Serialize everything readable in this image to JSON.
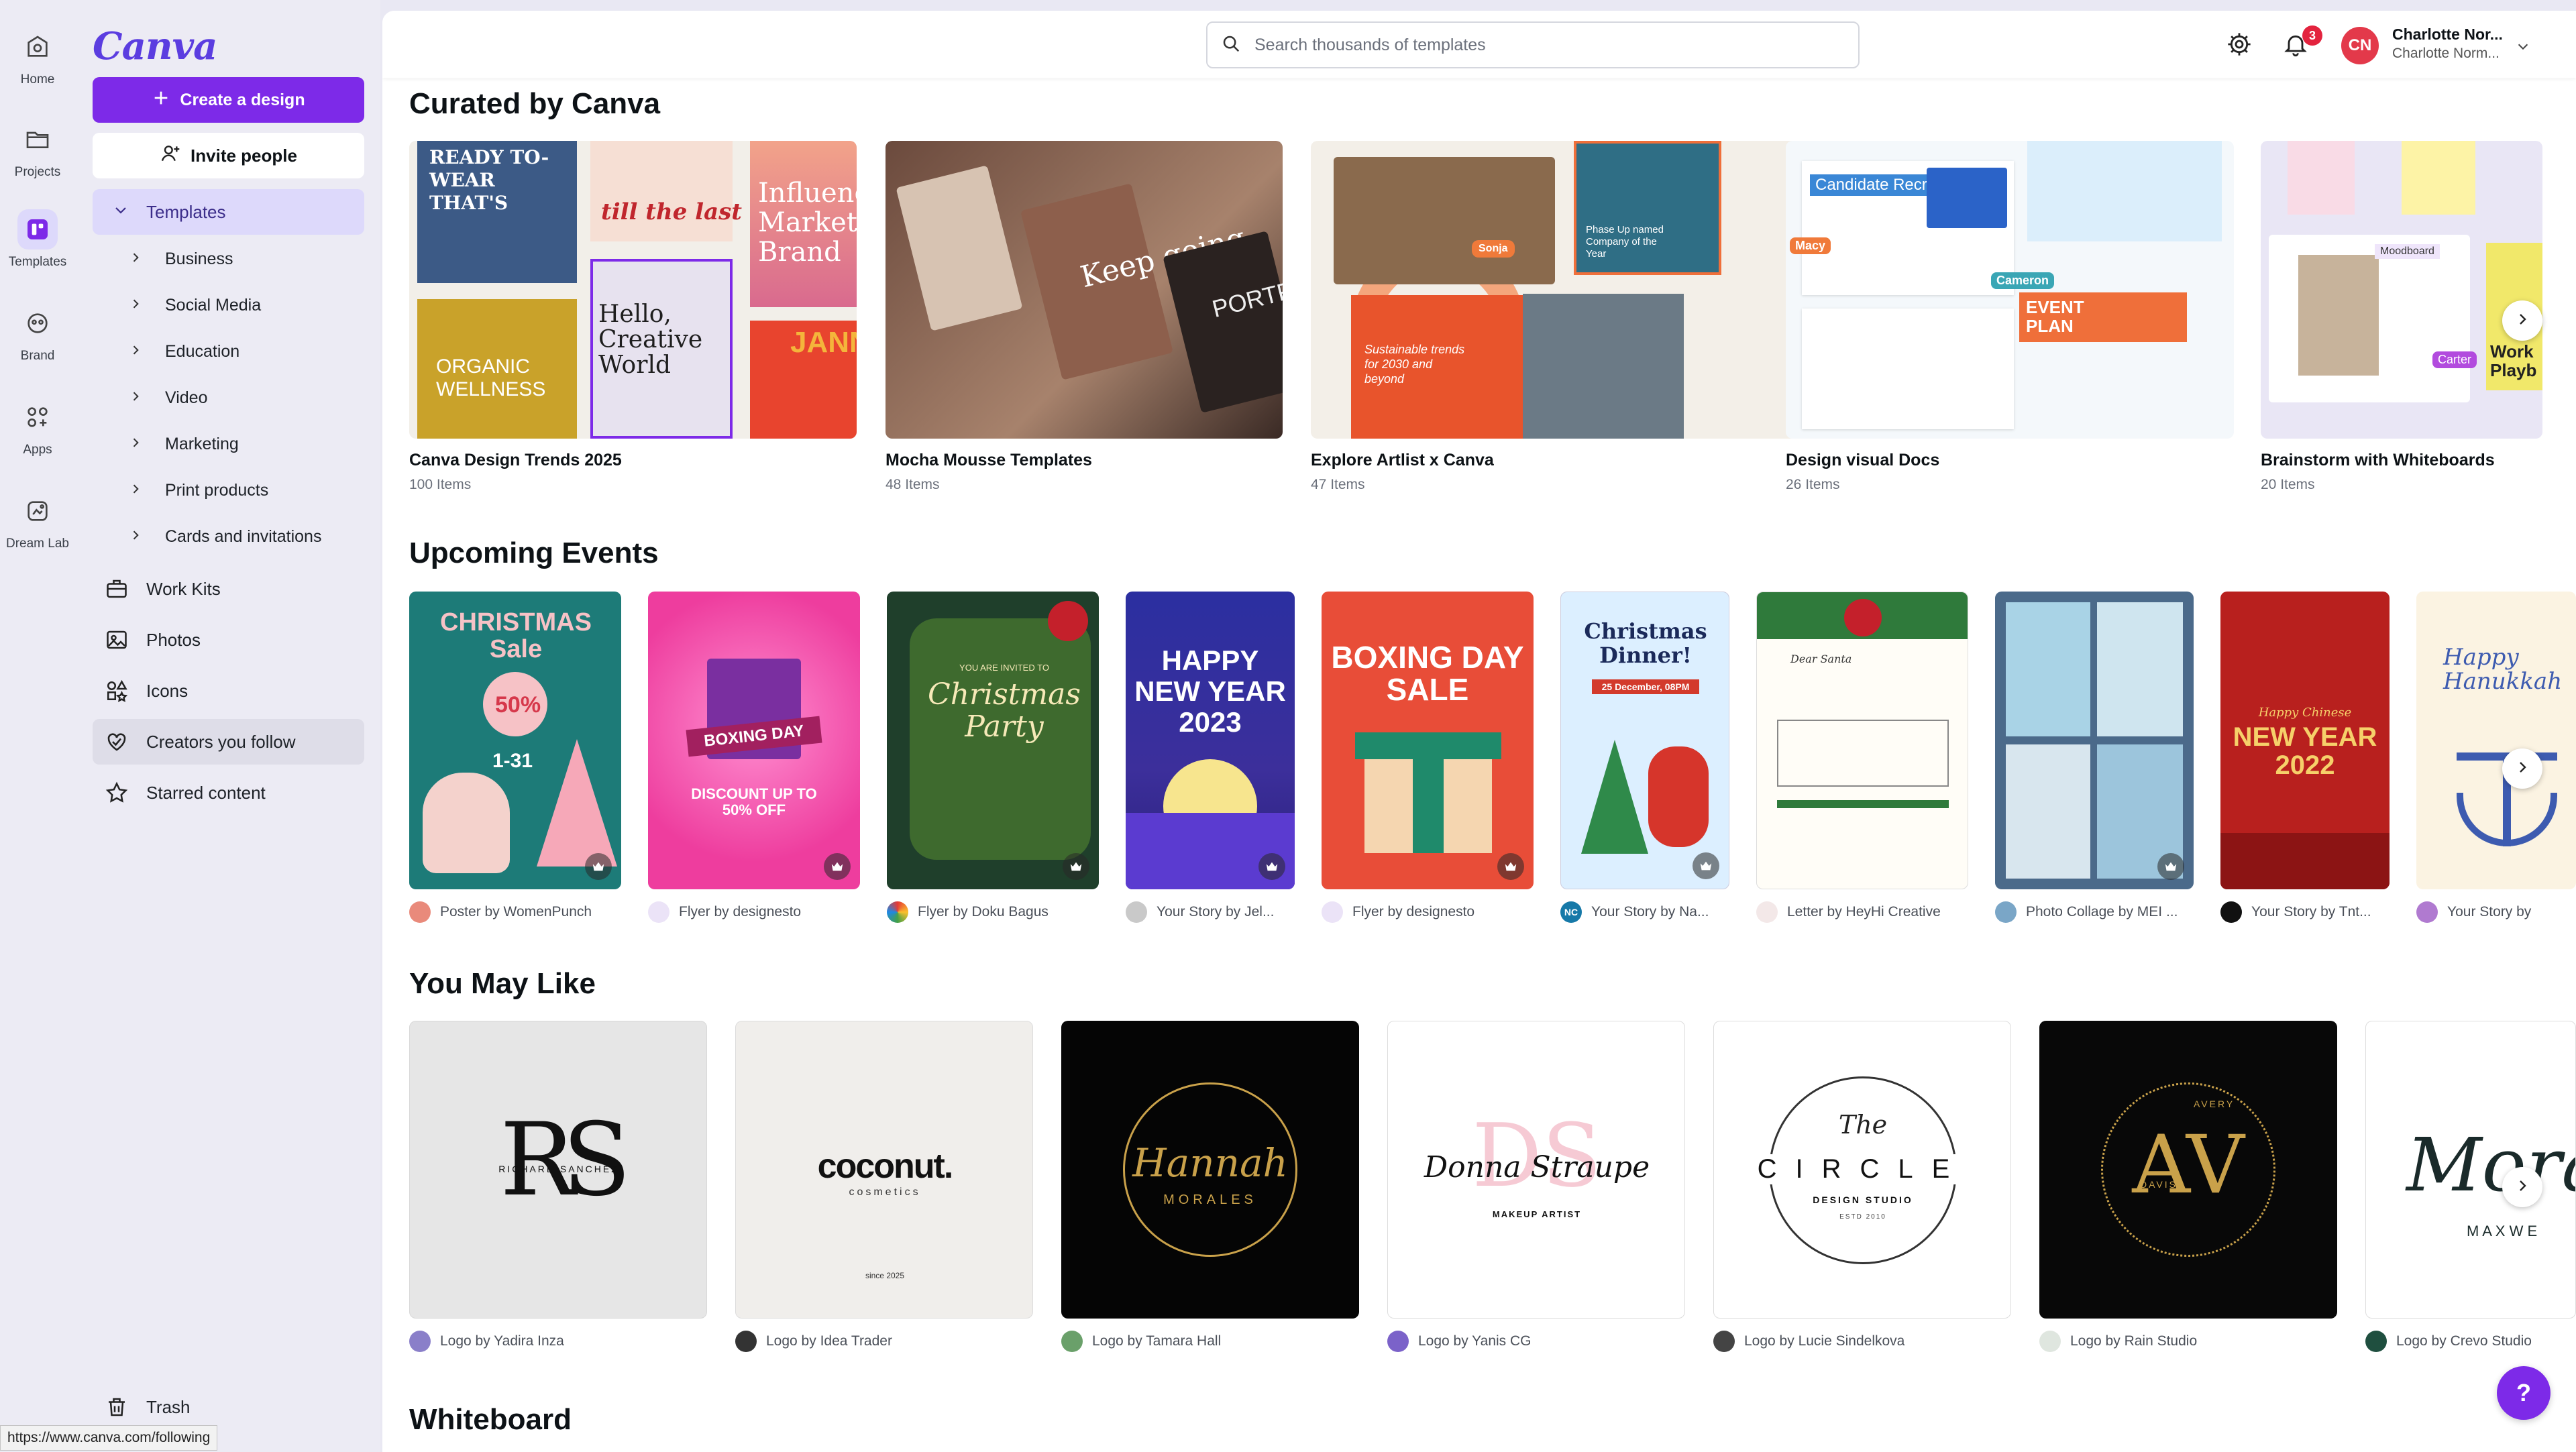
{
  "rail": [
    {
      "label": "Home",
      "icon": "home-icon"
    },
    {
      "label": "Projects",
      "icon": "folder-icon"
    },
    {
      "label": "Templates",
      "icon": "templates-icon"
    },
    {
      "label": "Brand",
      "icon": "brand-icon"
    },
    {
      "label": "Apps",
      "icon": "apps-icon"
    },
    {
      "label": "Dream Lab",
      "icon": "dream-lab-icon"
    }
  ],
  "sidebar": {
    "logo": "Canva",
    "create_label": "Create a design",
    "invite_label": "Invite people",
    "templates_label": "Templates",
    "sub_items": [
      "Business",
      "Social Media",
      "Education",
      "Video",
      "Marketing",
      "Print products",
      "Cards and invitations"
    ],
    "nav": [
      "Work Kits",
      "Photos",
      "Icons",
      "Creators you follow",
      "Starred content"
    ],
    "trash_label": "Trash"
  },
  "topbar": {
    "search_placeholder": "Search thousands of templates",
    "notif_count": "3",
    "avatar_initials": "CN",
    "user_name": "Charlotte Nor...",
    "user_sub": "Charlotte Norm..."
  },
  "curated": {
    "title": "Curated by Canva",
    "cards": [
      {
        "title": "Canva Design Trends 2025",
        "count": "100 Items"
      },
      {
        "title": "Mocha Mousse Templates",
        "count": "48 Items"
      },
      {
        "title": "Explore Artlist x Canva",
        "count": "47 Items"
      },
      {
        "title": "Design visual Docs",
        "count": "26 Items"
      },
      {
        "title": "Brainstorm with Whiteboards",
        "count": "20 Items"
      }
    ],
    "thumb_text": {
      "c1a": "READY TO-WEAR THAT'S",
      "c1b": "till the last bite",
      "c1c": "Influence Marketing Brand",
      "c1d": "ORGANIC WELLNESS",
      "c1e": "Hello, Creative World",
      "c1f": "JANN",
      "c2a": "Keep going.",
      "c2b": "PORTF",
      "c3a": "Sonja",
      "c3b": "Phase Up named Company of the Year",
      "c3c": "Sustainable trends for 2030 and beyond",
      "c4a": "Candidate Recruitment",
      "c4b": "Macy",
      "c4c": "Cameron",
      "c4d": "EVENT PLAN",
      "c5a": "Moodboard",
      "c5b": "Carter",
      "c5c": "Work Playb"
    }
  },
  "events": {
    "title": "Upcoming Events",
    "items": [
      {
        "by": "Poster by WomenPunch",
        "text": "CHRISTMAS Sale"
      },
      {
        "by": "Flyer by designesto",
        "text": "BOXING DAY"
      },
      {
        "by": "Flyer by Doku Bagus",
        "text": "Christmas Party"
      },
      {
        "by": "Your Story by Jel...",
        "text": "HAPPY NEW YEAR 2023"
      },
      {
        "by": "Flyer by designesto",
        "text": "BOXING DAY SALE"
      },
      {
        "by": "Your Story by Na...",
        "text": "Christmas Dinner!"
      },
      {
        "by": "Letter by HeyHi Creative",
        "text": "Dear Santa"
      },
      {
        "by": "Photo Collage by MEI ...",
        "text": ""
      },
      {
        "by": "Your Story by Tnt...",
        "text": "NEW YEAR 2022"
      },
      {
        "by": "Your Story by",
        "text": "Happy Hanukkah"
      }
    ],
    "extra_text": {
      "e1b": "50%",
      "e1c": "1-31",
      "e2b": "DISCOUNT UP TO 50% OFF",
      "e3a": "YOU ARE INVITED TO",
      "e6a": "25 December, 08PM",
      "e6b": "NC",
      "e8a": "Happy Chinese"
    }
  },
  "like": {
    "title": "You May Like",
    "items": [
      {
        "by": "Logo by Yadira Inza",
        "text": "RS"
      },
      {
        "by": "Logo by Idea Trader",
        "text": "coconut."
      },
      {
        "by": "Logo by Tamara Hall",
        "text": "Hannah"
      },
      {
        "by": "Logo by Yanis CG",
        "text": "Donna Straupe"
      },
      {
        "by": "Logo by Lucie Sindelkova",
        "text": "CIRCLE"
      },
      {
        "by": "Logo by Rain Studio",
        "text": "AV"
      },
      {
        "by": "Logo by Crevo Studio",
        "text": "Mora"
      }
    ],
    "extra_text": {
      "l1b": "RICHARD SANCHEZ",
      "l2b": "cosmetics",
      "l2c": "since 2025",
      "l3b": "MORALES",
      "l4b": "MAKEUP ARTIST",
      "l5a": "The",
      "l5b": "DESIGN STUDIO",
      "l5c": "ESTD 2010",
      "l6b": "AVERY",
      "l6c": "DAVIS",
      "l7b": "M A X W E"
    }
  },
  "whiteboard": {
    "title": "Whiteboard"
  },
  "help_label": "?",
  "status_url": "https://www.canva.com/following",
  "colors": {
    "accent": "#7d2ae8",
    "sidebar_bg": "#ecebf4",
    "active_bg": "#ddd9fb"
  }
}
